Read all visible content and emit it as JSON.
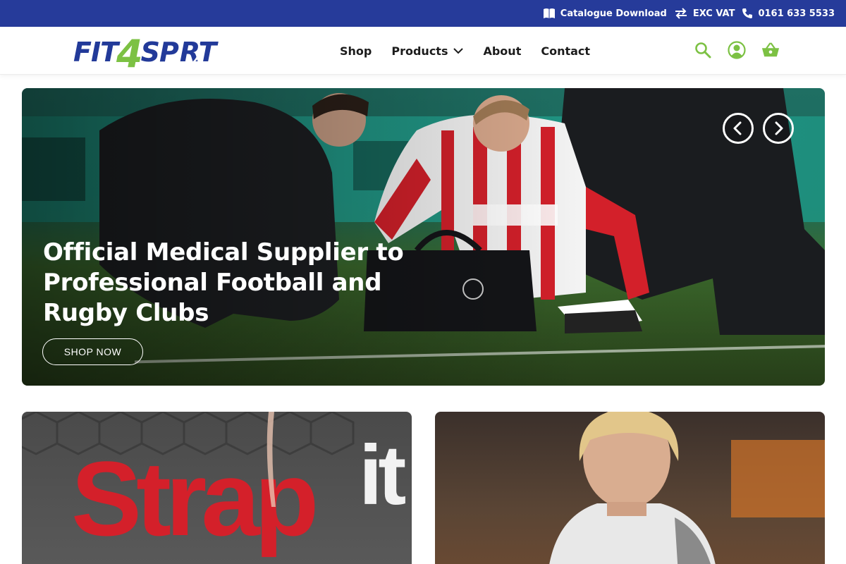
{
  "topbar": {
    "catalogue_label": "Catalogue Download",
    "vat_label": "EXC VAT",
    "phone_label": "0161 633 5533",
    "background": "#263b9a"
  },
  "header": {
    "logo": {
      "part1": "FIT",
      "part2": "4",
      "part3": "SP",
      "part4": "RT"
    },
    "nav": [
      {
        "label": "Shop"
      },
      {
        "label": "Products"
      },
      {
        "label": "About"
      },
      {
        "label": "Contact"
      }
    ],
    "icons": [
      "search-icon",
      "account-icon",
      "basket-icon"
    ],
    "accent": "#7cc143"
  },
  "hero": {
    "title": "Official Medical Supplier to Professional Football and Rugby Clubs",
    "button_label": "SHOP NOW",
    "prev_icon": "chevron-left-icon",
    "next_icon": "chevron-right-icon"
  },
  "promo": {
    "left_brand_a": "Strap",
    "left_brand_b": "it"
  }
}
